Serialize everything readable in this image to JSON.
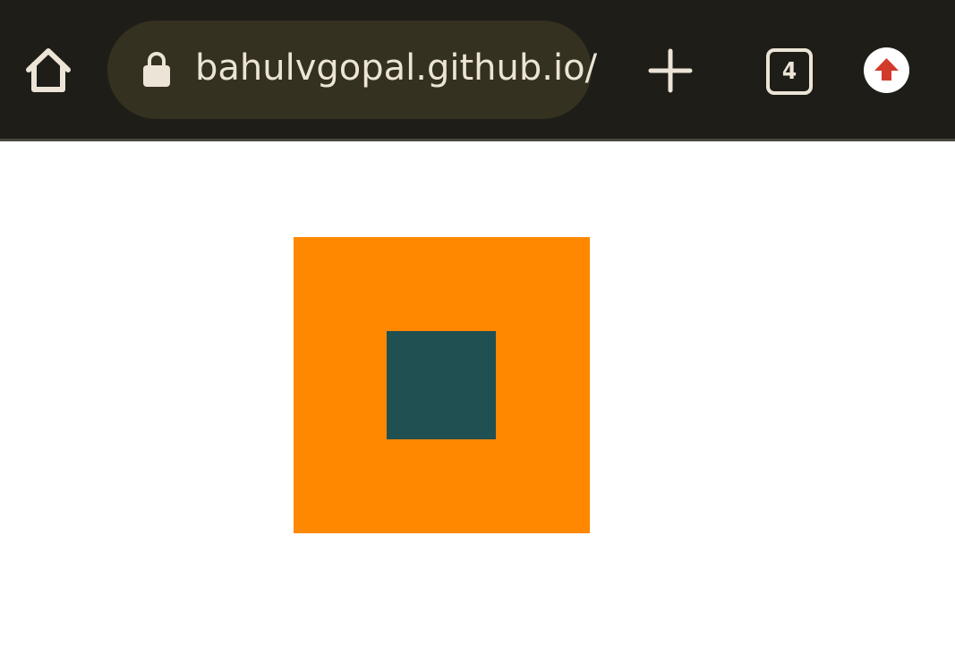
{
  "browser": {
    "url": "bahulvgopal.github.io/",
    "tab_count": "4",
    "icons": {
      "home": "home-icon",
      "lock": "lock-icon",
      "new_tab": "plus-icon",
      "update": "arrow-up-icon"
    },
    "colors": {
      "toolbar": "#1e1d18",
      "address_bar": "#353120",
      "foreground": "#ece4d6",
      "update_arrow": "#d23b2b"
    }
  },
  "page": {
    "colors": {
      "background": "#ffffff",
      "outer_square": "#ff8800",
      "inner_square": "#215052"
    }
  }
}
